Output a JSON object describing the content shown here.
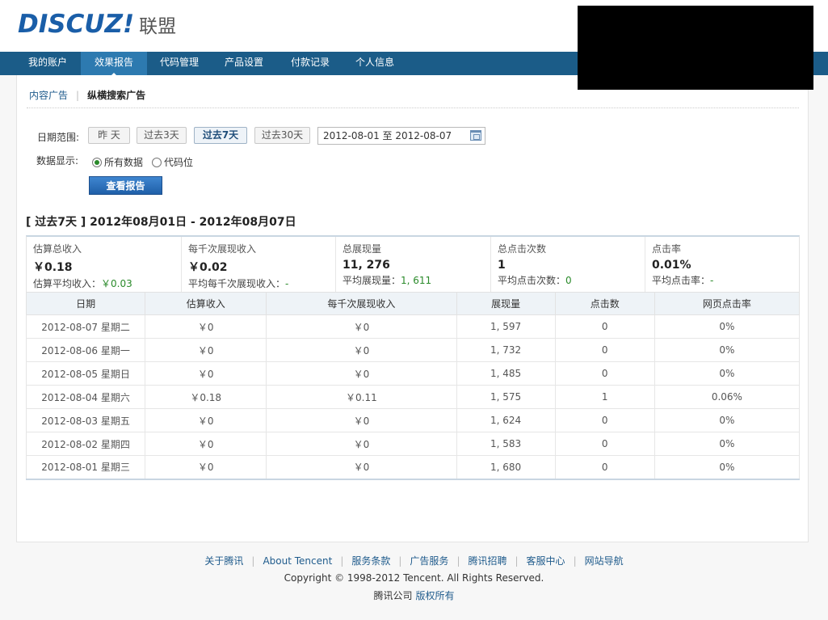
{
  "header": {
    "logo_main": "DISCUZ!",
    "logo_sub": "联盟"
  },
  "nav": {
    "items": [
      {
        "label": "我的账户"
      },
      {
        "label": "效果报告",
        "active": true
      },
      {
        "label": "代码管理"
      },
      {
        "label": "产品设置"
      },
      {
        "label": "付款记录"
      },
      {
        "label": "个人信息"
      }
    ]
  },
  "subnav": {
    "content_ad": "内容广告",
    "separator": "|",
    "search_ad": "纵横搜索广告"
  },
  "filter": {
    "date_range_label": "日期范围:",
    "buttons": [
      "昨 天",
      "过去3天",
      "过去7天",
      "过去30天"
    ],
    "active_button": "过去7天",
    "date_value": "2012-08-01 至  2012-08-07",
    "data_display_label": "数据显示:",
    "radio_all": "所有数据",
    "radio_slot": "代码位",
    "view_button": "查看报告"
  },
  "period_title": "[ 过去7天  ] 2012年08月01日  - 2012年08月07日",
  "summary": [
    {
      "label": "估算总收入",
      "value": "￥0.18",
      "avg_label": "估算平均收入：",
      "avg_value": "￥0.03"
    },
    {
      "label": "每千次展现收入",
      "value": "￥0.02",
      "avg_label": "平均每千次展现收入：",
      "avg_value": "-"
    },
    {
      "label": "总展现量",
      "value": "11, 276",
      "avg_label": "平均展现量：",
      "avg_value": "1, 611"
    },
    {
      "label": "总点击次数",
      "value": "1",
      "avg_label": "平均点击次数：",
      "avg_value": "0"
    },
    {
      "label": "点击率",
      "value": "0.01%",
      "avg_label": "平均点击率：",
      "avg_value": "-"
    }
  ],
  "table": {
    "headers": [
      "日期",
      "估算收入",
      "每千次展现收入",
      "展现量",
      "点击数",
      "网页点击率"
    ],
    "rows": [
      [
        "2012-08-07 星期二",
        "￥0",
        "￥0",
        "1, 597",
        "0",
        "0%"
      ],
      [
        "2012-08-06 星期一",
        "￥0",
        "￥0",
        "1, 732",
        "0",
        "0%"
      ],
      [
        "2012-08-05 星期日",
        "￥0",
        "￥0",
        "1, 485",
        "0",
        "0%"
      ],
      [
        "2012-08-04 星期六",
        "￥0.18",
        "￥0.11",
        "1, 575",
        "1",
        "0.06%"
      ],
      [
        "2012-08-03 星期五",
        "￥0",
        "￥0",
        "1, 624",
        "0",
        "0%"
      ],
      [
        "2012-08-02 星期四",
        "￥0",
        "￥0",
        "1, 583",
        "0",
        "0%"
      ],
      [
        "2012-08-01 星期三",
        "￥0",
        "￥0",
        "1, 680",
        "0",
        "0%"
      ]
    ]
  },
  "footer": {
    "links": [
      "关于腾讯",
      "About Tencent",
      "服务条款",
      "广告服务",
      "腾讯招聘",
      "客服中心",
      "网站导航"
    ],
    "link_separator": "|",
    "copyright": "Copyright © 1998-2012 Tencent. All Rights Reserved.",
    "owner": "腾讯公司",
    "owner_link": "版权所有"
  }
}
